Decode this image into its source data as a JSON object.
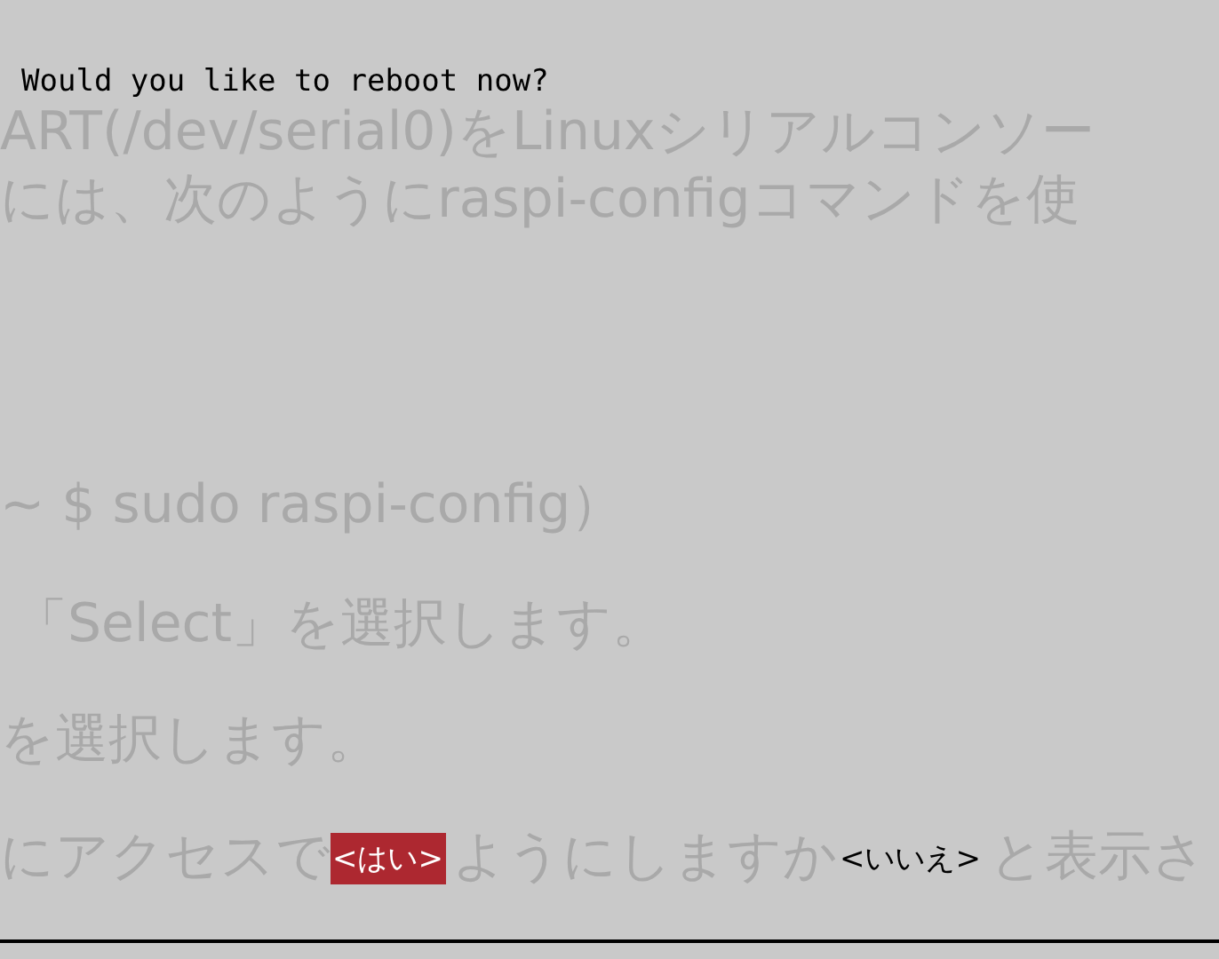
{
  "background_text": {
    "lines": [
      "ART(/dev/serial0)をLinuxシリアルコンソー",
      "には、次のようにraspi-configコマンドを使",
      "~ $ sudo raspi-config）",
      "「Select」を選択します。",
      "を選択します。"
    ]
  },
  "dialog": {
    "message": "Would you like to reboot now?"
  },
  "bottom_row": [
    {
      "kind": "text",
      "text": "にアクセスで"
    },
    {
      "kind": "button",
      "label": "<はい>",
      "selected": true
    },
    {
      "kind": "text",
      "text": "ようにしますか"
    },
    {
      "kind": "button",
      "label": "<いいえ>",
      "selected": false
    },
    {
      "kind": "text",
      "text": "と表示さ"
    }
  ]
}
